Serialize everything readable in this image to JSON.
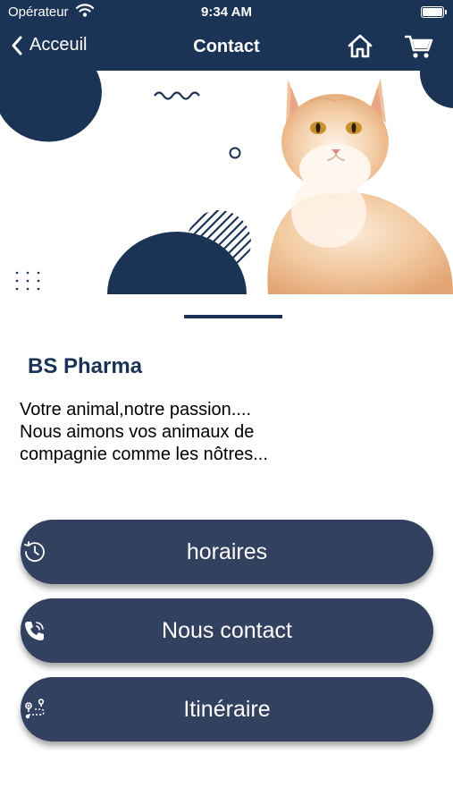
{
  "status_bar": {
    "carrier": "Opérateur",
    "time": "9:34 AM"
  },
  "nav": {
    "back_label": "Acceuil",
    "title": "Contact"
  },
  "business": {
    "name": "BS Pharma",
    "tagline": "Votre animal,notre passion....\nNous aimons vos animaux de\ncompagnie comme les nôtres..."
  },
  "buttons": [
    {
      "label": "horaires",
      "icon": "clock-icon"
    },
    {
      "label": "Nous contact",
      "icon": "phone-icon"
    },
    {
      "label": "Itinéraire",
      "icon": "route-icon"
    }
  ],
  "colors": {
    "primary": "#1b3354",
    "button": "#324160",
    "background": "#ffffff"
  }
}
